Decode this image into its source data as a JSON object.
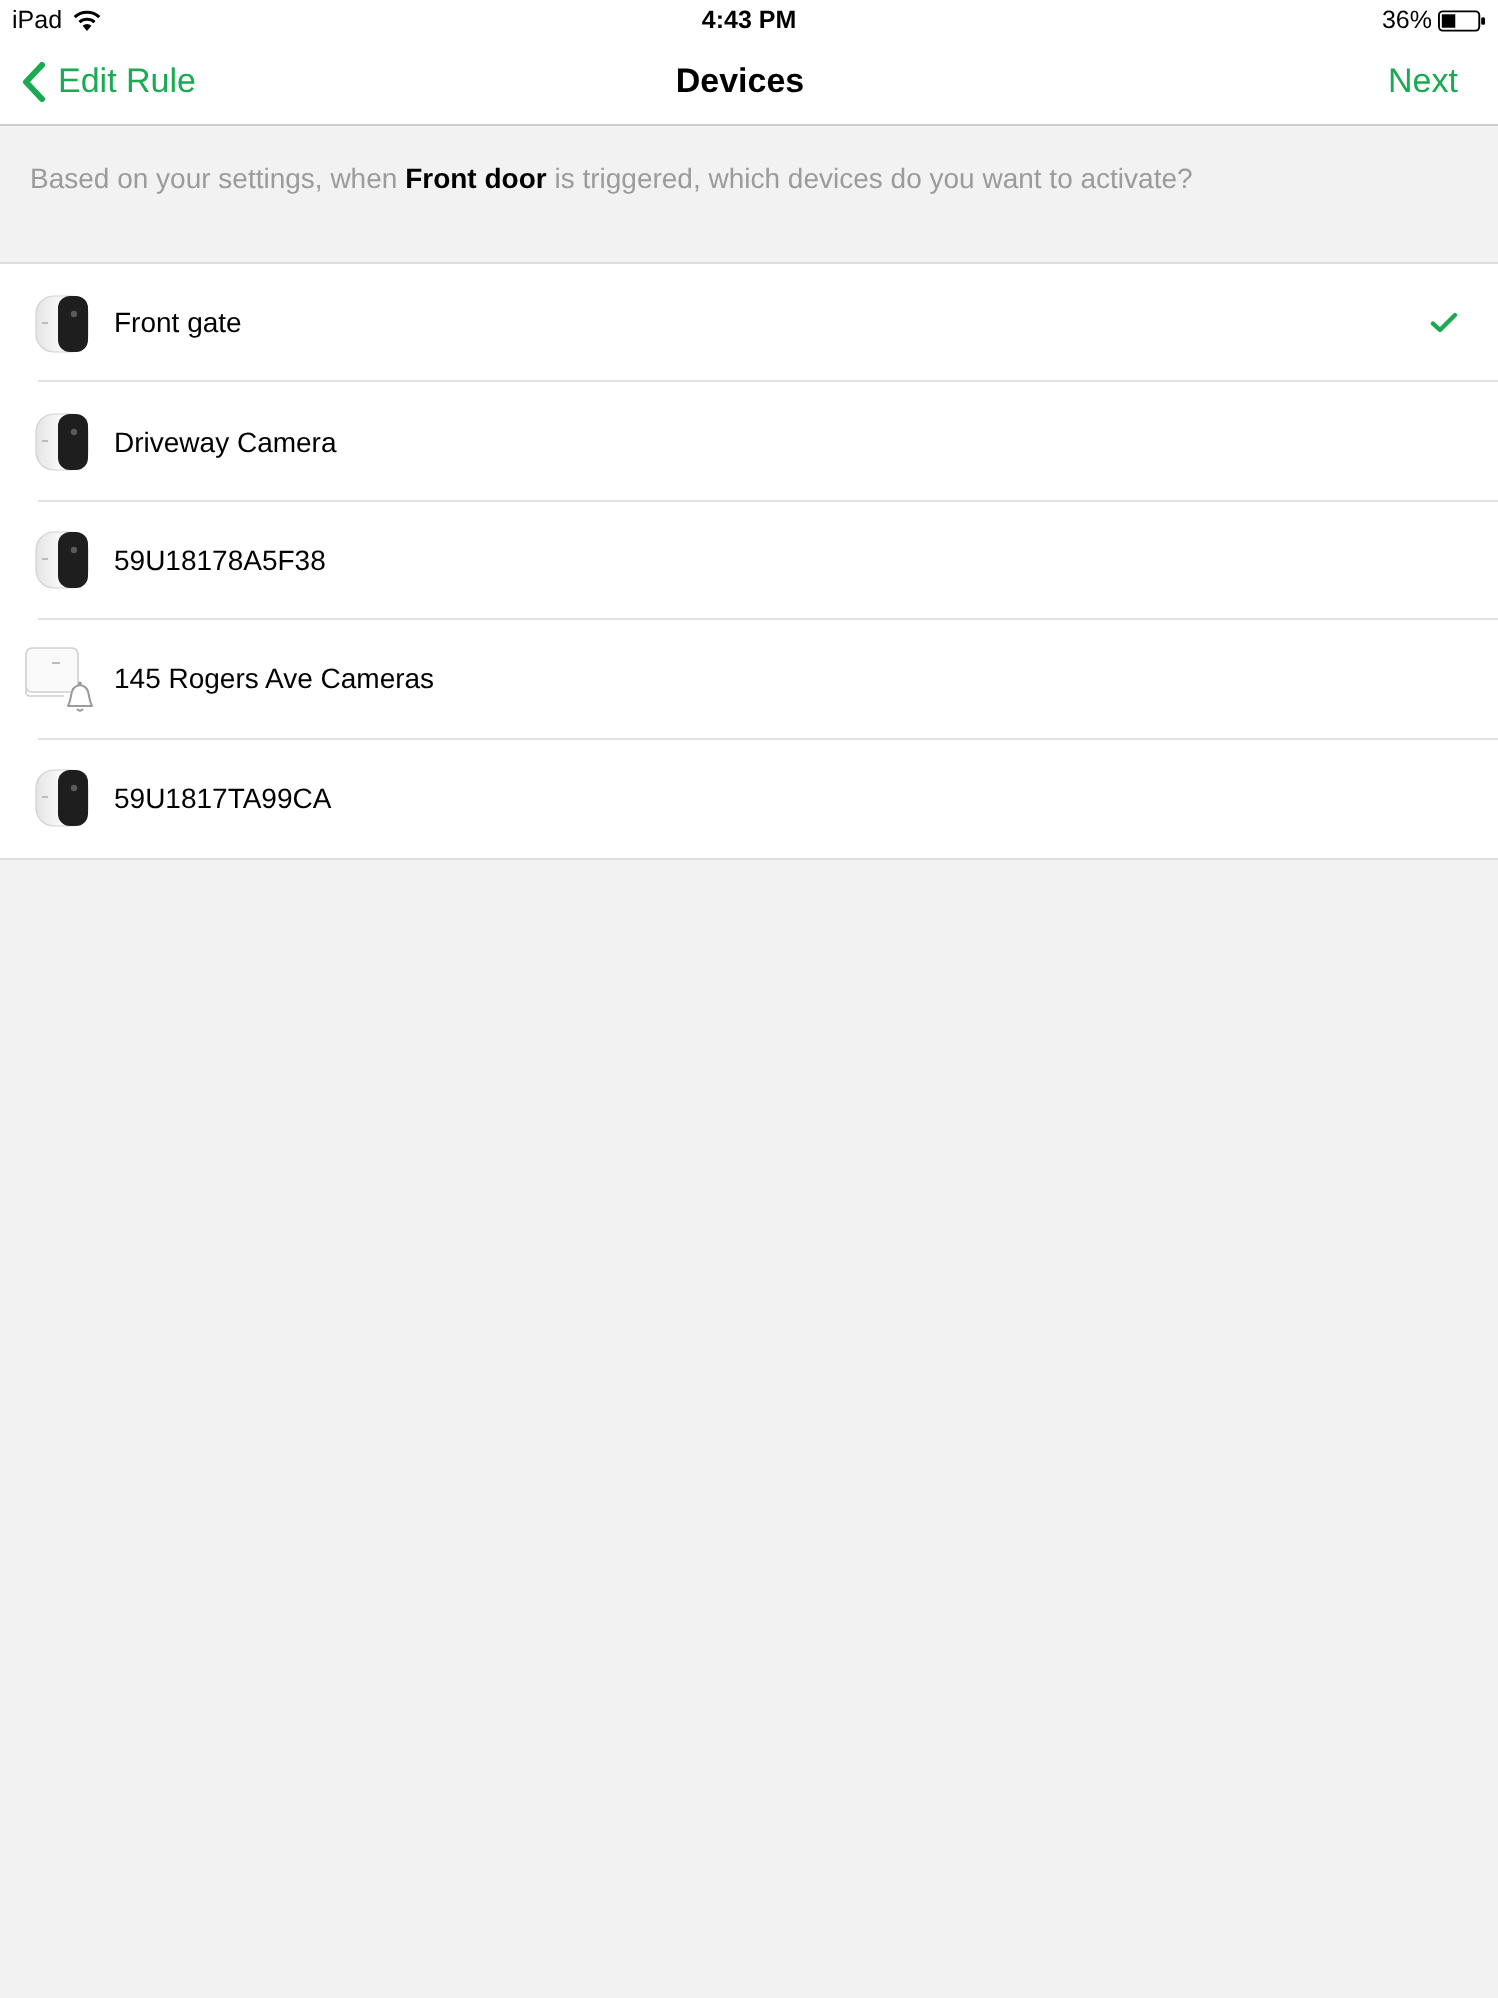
{
  "status_bar": {
    "carrier": "iPad",
    "time": "4:43 PM",
    "battery": "36%"
  },
  "nav_bar": {
    "back": "Edit Rule",
    "title": "Devices",
    "action": "Next"
  },
  "prompt": "Based on your settings, when **Front door** is triggered, which devices do you want to activate?",
  "devices": [
    {
      "kind": "camera",
      "name": "Front gate",
      "selected": true
    },
    {
      "kind": "camera",
      "name": "Driveway Camera",
      "selected": false
    },
    {
      "kind": "camera",
      "name": "59U18178A5F38",
      "selected": false
    },
    {
      "kind": "base_station",
      "name": "145 Rogers Ave Cameras",
      "selected": false
    },
    {
      "kind": "camera",
      "name": "59U1817TA99CA",
      "selected": false
    }
  ]
}
